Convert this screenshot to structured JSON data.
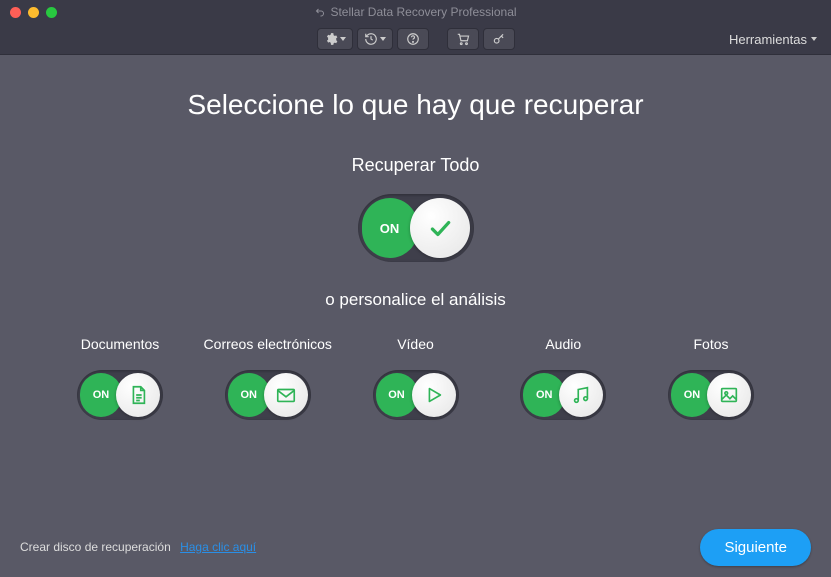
{
  "window": {
    "title": "Stellar Data Recovery Professional"
  },
  "toolbar": {
    "tools_label": "Herramientas"
  },
  "headings": {
    "main": "Seleccione lo que hay que recuperar",
    "recover_all": "Recuperar Todo",
    "customize": "o personalice el análisis"
  },
  "toggle": {
    "on_text": "ON",
    "state": true
  },
  "categories": [
    {
      "key": "documents",
      "label": "Documentos",
      "state": "ON",
      "icon": "document"
    },
    {
      "key": "emails",
      "label": "Correos electrónicos",
      "state": "ON",
      "icon": "mail"
    },
    {
      "key": "video",
      "label": "Vídeo",
      "state": "ON",
      "icon": "play"
    },
    {
      "key": "audio",
      "label": "Audio",
      "state": "ON",
      "icon": "music"
    },
    {
      "key": "photos",
      "label": "Fotos",
      "state": "ON",
      "icon": "image"
    }
  ],
  "footer": {
    "disk_text": "Crear disco de recuperación",
    "disk_link": "Haga clic aquí",
    "next": "Siguiente"
  },
  "colors": {
    "accent_green": "#2fb457",
    "accent_blue": "#1d9ff5",
    "bg": "#595966"
  }
}
